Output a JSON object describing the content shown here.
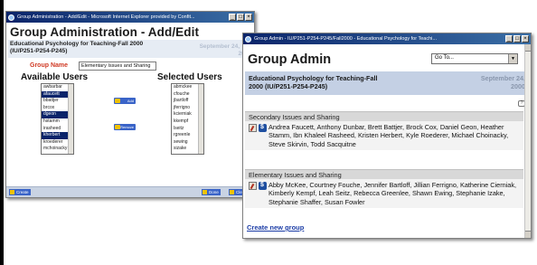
{
  "left_window": {
    "title": "Group Administration - Add/Edit - Microsoft Internet Explorer provided by Confit...",
    "heading": "Group Administration - Add/Edit",
    "course": "Educational Psychology for Teaching-Fall 2000",
    "course_code": "(IU/P251-P254-P245)",
    "date": "September 24,",
    "year": "2000",
    "help_icon": "?",
    "group_name_label": "Group Name",
    "group_name_value": "Elementary Issues and Sharing",
    "available_label": "Available Users",
    "selected_label": "Selected Users",
    "available_users": [
      "awbarbar",
      "afaucett",
      "bbattjer",
      "brcox",
      "dgeon",
      "hstamm",
      "irasheed",
      "kherbert",
      "kroederer",
      "mchoinacky"
    ],
    "selected_users": [
      "abmckee",
      "cfouche",
      "jbartloff",
      "jferrigno",
      "kcierniak",
      "kkempf",
      "lseitz",
      "rgreenle",
      "sewing",
      "sizake"
    ],
    "add_label": "Add",
    "remove_label": "Remove",
    "footer": {
      "create": "Create",
      "done": "Done",
      "clear": "Clear"
    }
  },
  "right_window": {
    "title": "Group Admin - IU/P251-P254-P245/Fall2000 - Educational Psychology for Teachi...",
    "heading": "Group Admin",
    "goto_label": "Go To...",
    "course": "Educational Psychology for Teaching-Fall",
    "course_line2": "2000 (IU/P251-P254-P245)",
    "date": "September 24,",
    "year": "2000",
    "help_icon": "?",
    "groups": [
      {
        "name": "Secondary Issues and Sharing",
        "members": "Andrea Faucett, Anthony Dunbar, Brett Battjer, Brock Cox, Daniel Geon, Heather Stamm, Ibn Khaleel Rasheed, Kristen Herbert, Kyle Roederer, Michael Choinacky, Steve Skirvin, Todd Sacquitne"
      },
      {
        "name": "Elementary Issues and Sharing",
        "members": "Abby McKee, Courtney Fouche, Jennifer Bartloff, Jillian Ferrigno, Katherine Cierniak, Kimberly Kempf, Leah Seitz, Rebecca Greenlee, Shawn Ewing, Stephanie Izake, Stephanie Shaffer, Susan Fowler"
      }
    ],
    "create_link": "Create new group"
  }
}
